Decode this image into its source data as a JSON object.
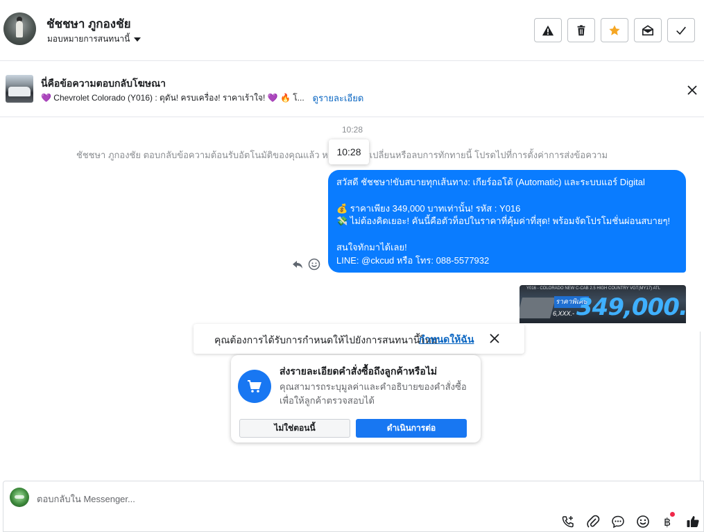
{
  "header": {
    "name": "ชัชชษา ภูกองชัย",
    "assign_label": "มอบหมายการสนทนานี้",
    "actions": [
      "warning",
      "delete",
      "star",
      "mark-unread",
      "done"
    ]
  },
  "ad_reply": {
    "title": "นี่คือข้อความตอบกลับโฆษณา",
    "subtitle": "💜 Chevrolet Colorado (Y016) : ดุดัน! ครบเครื่อง! ราคาเร้าใจ! 💜 🔥 โ...",
    "more_link": "ดูรายละเอียด"
  },
  "thread": {
    "time": "10:28",
    "tooltip_time": "10:28",
    "system_message": "ชัชชษา ภูกองชัย ตอบกลับข้อความต้อนรับอัตโนมัติของคุณแล้ว หากต้องการเปลี่ยนหรือลบการทักทายนี้ โปรดไปที่การตั้งค่าการส่งข้อความ",
    "bubble_lines": [
      "สวัสดี ชัชชษา!ขับสบายทุกเส้นทาง: เกียร์ออโต้ (Automatic) และระบบแอร์ Digital",
      "",
      "💰 ราคาเพียง 349,000 บาทเท่านั้น! รหัส : Y016",
      "💸 ไม่ต้องคิดเยอะ! คันนี้คือตัวท็อปในราคาที่คุ้มค่าที่สุด! พร้อมจัดโปรโมชั่นผ่อนสบายๆ!",
      "",
      "สนใจทักมาได้เลย!",
      "LINE: @ckcud หรือ โทร: 088-5577932"
    ],
    "image": {
      "headline": "Y016 - COLORADO NEW C-CAB 2.5 HIGH COUNTRY VGT(MY17) ATL",
      "price": "349,000.-",
      "tag": "ราคาพิเศษ",
      "small": "6,XXX.-"
    }
  },
  "notification": {
    "question": "คุณต้องการได้รับการกำหนดให้ไปยังการสนทนานี้ไหม",
    "link": "กำหนดให้ฉัน"
  },
  "order_card": {
    "title": "ส่งรายละเอียดคำสั่งซื้อถึงลูกค้าหรือไม่",
    "description": "คุณสามารถระบุมูลค่าและคำอธิบายของคำสั่งซื้อเพื่อให้ลูกค้าตรวจสอบได้",
    "secondary_button": "ไม่ใช่ตอนนี้",
    "primary_button": "ดำเนินการต่อ"
  },
  "composer": {
    "placeholder": "ตอบกลับใน Messenger...",
    "tools": [
      "add-call-icon",
      "attach-icon",
      "saved-replies-icon",
      "emoji-icon",
      "payment-icon",
      "like-icon"
    ]
  },
  "colors": {
    "bubble": "#0a7cff",
    "primary": "#1877f2",
    "link": "#0a66c2",
    "star": "#f5a623"
  }
}
